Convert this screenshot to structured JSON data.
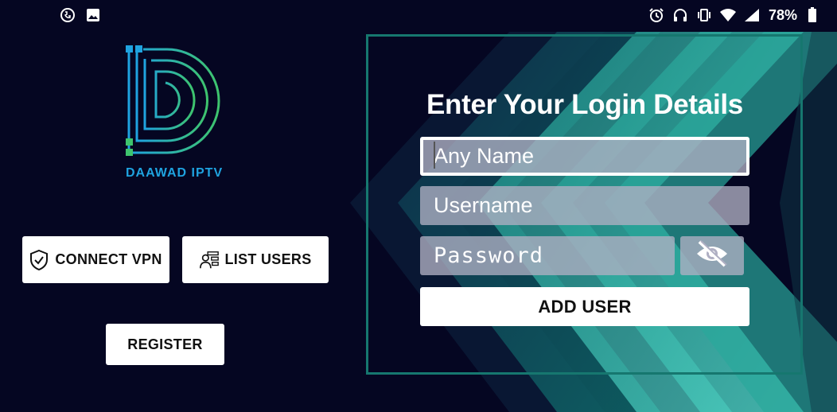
{
  "status_bar": {
    "left_icons": [
      "viber-icon",
      "gallery-icon"
    ],
    "right_icons": [
      "alarm-icon",
      "headphones-icon",
      "vibrate-icon",
      "wifi-icon",
      "signal-icon",
      "battery-icon"
    ],
    "battery": "78%"
  },
  "brand": {
    "name": "DAAWAD IPTV"
  },
  "left_actions": {
    "connect_vpn": "CONNECT VPN",
    "list_users": "LIST USERS",
    "register": "REGISTER"
  },
  "login": {
    "title": "Enter Your Login Details",
    "name_placeholder": "Any Name",
    "username_placeholder": "Username",
    "password_placeholder": "Password",
    "add_user": "ADD USER"
  },
  "colors": {
    "background": "#050622",
    "accent_teal": "#16776f",
    "logo_blue": "#1fa3e0",
    "logo_green": "#3ec46d"
  }
}
